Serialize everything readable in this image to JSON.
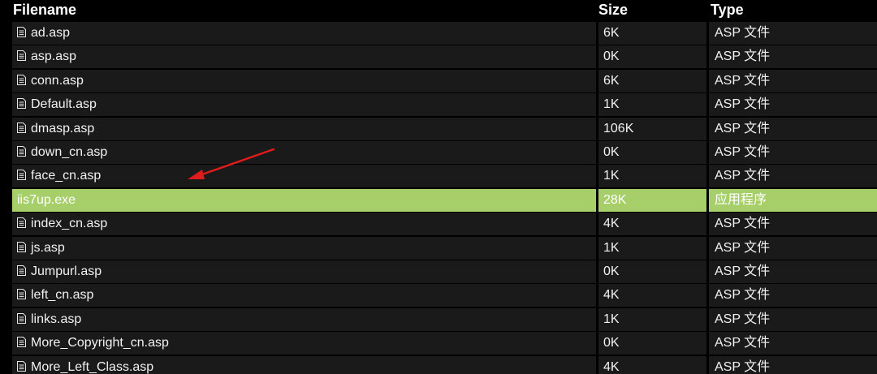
{
  "columns": {
    "filename": "Filename",
    "size": "Size",
    "type": "Type"
  },
  "colors": {
    "background": "#000000",
    "cell": "#1a1a1a",
    "highlight": "#a6cf6a",
    "arrow": "#e01b1b"
  },
  "icons": {
    "file": "document-icon"
  },
  "files": [
    {
      "name": "ad.asp",
      "size": "6K",
      "type": "ASP 文件"
    },
    {
      "name": "asp.asp",
      "size": "0K",
      "type": "ASP 文件"
    },
    {
      "name": "conn.asp",
      "size": "6K",
      "type": "ASP 文件"
    },
    {
      "name": "Default.asp",
      "size": "1K",
      "type": "ASP 文件"
    },
    {
      "name": "dmasp.asp",
      "size": "106K",
      "type": "ASP 文件"
    },
    {
      "name": "down_cn.asp",
      "size": "0K",
      "type": "ASP 文件"
    },
    {
      "name": "face_cn.asp",
      "size": "1K",
      "type": "ASP 文件"
    },
    {
      "name": "iis7up.exe",
      "size": "28K",
      "type": "应用程序",
      "highlighted": true
    },
    {
      "name": "index_cn.asp",
      "size": "4K",
      "type": "ASP 文件"
    },
    {
      "name": "js.asp",
      "size": "1K",
      "type": "ASP 文件"
    },
    {
      "name": "Jumpurl.asp",
      "size": "0K",
      "type": "ASP 文件"
    },
    {
      "name": "left_cn.asp",
      "size": "4K",
      "type": "ASP 文件"
    },
    {
      "name": "links.asp",
      "size": "1K",
      "type": "ASP 文件"
    },
    {
      "name": "More_Copyright_cn.asp",
      "size": "0K",
      "type": "ASP 文件"
    },
    {
      "name": "More_Left_Class.asp",
      "size": "4K",
      "type": "ASP 文件"
    }
  ]
}
